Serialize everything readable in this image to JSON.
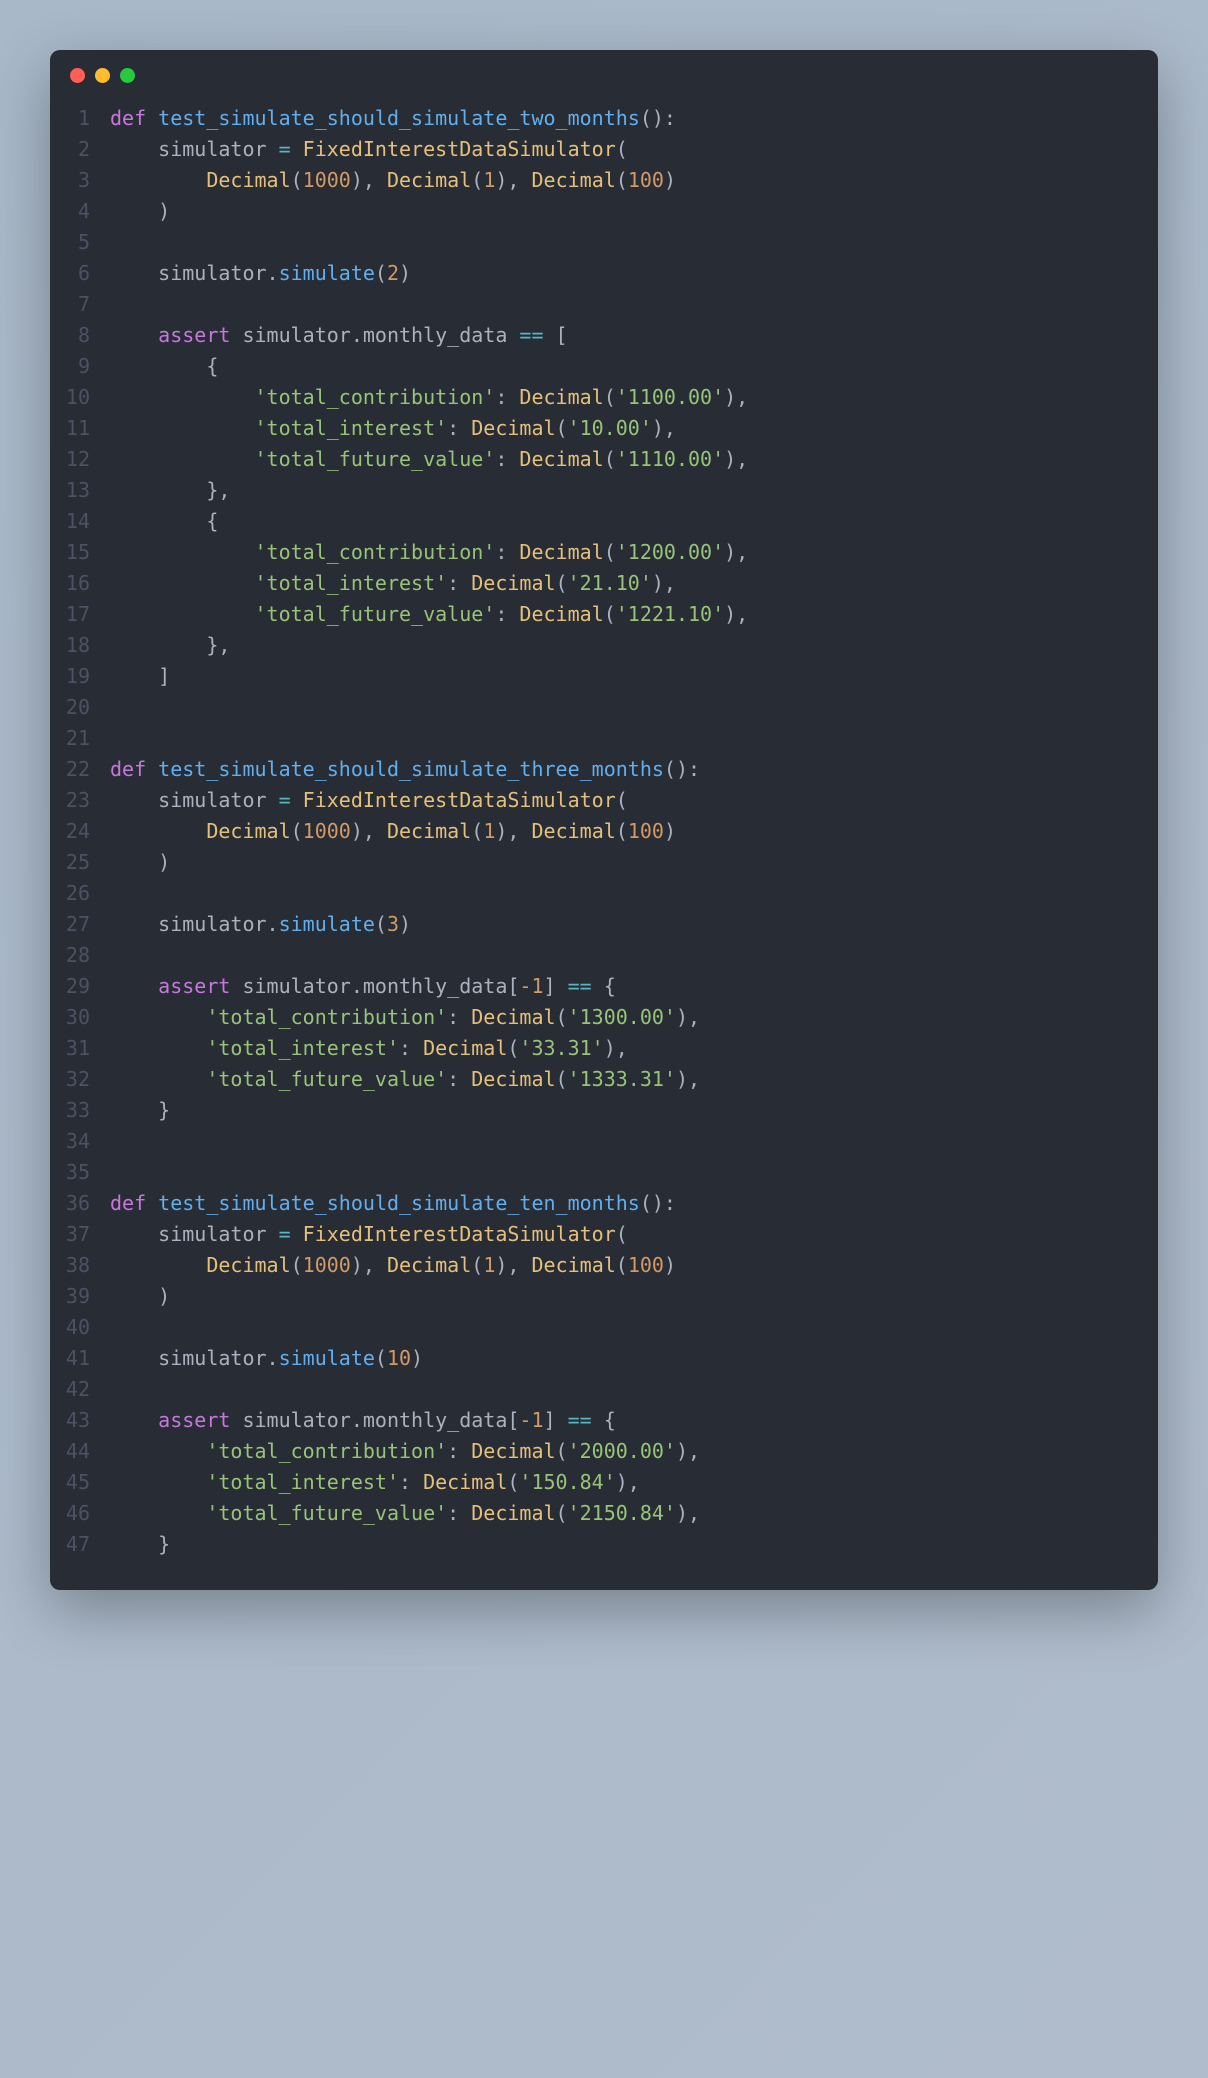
{
  "window": {
    "dots": [
      "red",
      "yellow",
      "green"
    ]
  },
  "code": {
    "lines": [
      {
        "n": 1,
        "tokens": [
          [
            "kw",
            "def"
          ],
          [
            "punct",
            " "
          ],
          [
            "fn",
            "test_simulate_should_simulate_two_months"
          ],
          [
            "punct",
            "():"
          ]
        ]
      },
      {
        "n": 2,
        "tokens": [
          [
            "punct",
            "    simulator "
          ],
          [
            "op",
            "="
          ],
          [
            "punct",
            " "
          ],
          [
            "cls",
            "FixedInterestDataSimulator"
          ],
          [
            "punct",
            "("
          ]
        ]
      },
      {
        "n": 3,
        "tokens": [
          [
            "punct",
            "        "
          ],
          [
            "cls",
            "Decimal"
          ],
          [
            "punct",
            "("
          ],
          [
            "num",
            "1000"
          ],
          [
            "punct",
            "), "
          ],
          [
            "cls",
            "Decimal"
          ],
          [
            "punct",
            "("
          ],
          [
            "num",
            "1"
          ],
          [
            "punct",
            "), "
          ],
          [
            "cls",
            "Decimal"
          ],
          [
            "punct",
            "("
          ],
          [
            "num",
            "100"
          ],
          [
            "punct",
            ")"
          ]
        ]
      },
      {
        "n": 4,
        "tokens": [
          [
            "punct",
            "    )"
          ]
        ]
      },
      {
        "n": 5,
        "tokens": []
      },
      {
        "n": 6,
        "tokens": [
          [
            "punct",
            "    simulator."
          ],
          [
            "fn",
            "simulate"
          ],
          [
            "punct",
            "("
          ],
          [
            "num",
            "2"
          ],
          [
            "punct",
            ")"
          ]
        ]
      },
      {
        "n": 7,
        "tokens": []
      },
      {
        "n": 8,
        "tokens": [
          [
            "punct",
            "    "
          ],
          [
            "kw",
            "assert"
          ],
          [
            "punct",
            " simulator.monthly_data "
          ],
          [
            "op",
            "=="
          ],
          [
            "punct",
            " ["
          ]
        ]
      },
      {
        "n": 9,
        "tokens": [
          [
            "punct",
            "        {"
          ]
        ]
      },
      {
        "n": 10,
        "tokens": [
          [
            "punct",
            "            "
          ],
          [
            "str",
            "'total_contribution'"
          ],
          [
            "punct",
            ": "
          ],
          [
            "cls",
            "Decimal"
          ],
          [
            "punct",
            "("
          ],
          [
            "str",
            "'1100.00'"
          ],
          [
            "punct",
            "),"
          ]
        ]
      },
      {
        "n": 11,
        "tokens": [
          [
            "punct",
            "            "
          ],
          [
            "str",
            "'total_interest'"
          ],
          [
            "punct",
            ": "
          ],
          [
            "cls",
            "Decimal"
          ],
          [
            "punct",
            "("
          ],
          [
            "str",
            "'10.00'"
          ],
          [
            "punct",
            "),"
          ]
        ]
      },
      {
        "n": 12,
        "tokens": [
          [
            "punct",
            "            "
          ],
          [
            "str",
            "'total_future_value'"
          ],
          [
            "punct",
            ": "
          ],
          [
            "cls",
            "Decimal"
          ],
          [
            "punct",
            "("
          ],
          [
            "str",
            "'1110.00'"
          ],
          [
            "punct",
            "),"
          ]
        ]
      },
      {
        "n": 13,
        "tokens": [
          [
            "punct",
            "        },"
          ]
        ]
      },
      {
        "n": 14,
        "tokens": [
          [
            "punct",
            "        {"
          ]
        ]
      },
      {
        "n": 15,
        "tokens": [
          [
            "punct",
            "            "
          ],
          [
            "str",
            "'total_contribution'"
          ],
          [
            "punct",
            ": "
          ],
          [
            "cls",
            "Decimal"
          ],
          [
            "punct",
            "("
          ],
          [
            "str",
            "'1200.00'"
          ],
          [
            "punct",
            "),"
          ]
        ]
      },
      {
        "n": 16,
        "tokens": [
          [
            "punct",
            "            "
          ],
          [
            "str",
            "'total_interest'"
          ],
          [
            "punct",
            ": "
          ],
          [
            "cls",
            "Decimal"
          ],
          [
            "punct",
            "("
          ],
          [
            "str",
            "'21.10'"
          ],
          [
            "punct",
            "),"
          ]
        ]
      },
      {
        "n": 17,
        "tokens": [
          [
            "punct",
            "            "
          ],
          [
            "str",
            "'total_future_value'"
          ],
          [
            "punct",
            ": "
          ],
          [
            "cls",
            "Decimal"
          ],
          [
            "punct",
            "("
          ],
          [
            "str",
            "'1221.10'"
          ],
          [
            "punct",
            "),"
          ]
        ]
      },
      {
        "n": 18,
        "tokens": [
          [
            "punct",
            "        },"
          ]
        ]
      },
      {
        "n": 19,
        "tokens": [
          [
            "punct",
            "    ]"
          ]
        ]
      },
      {
        "n": 20,
        "tokens": []
      },
      {
        "n": 21,
        "tokens": []
      },
      {
        "n": 22,
        "tokens": [
          [
            "kw",
            "def"
          ],
          [
            "punct",
            " "
          ],
          [
            "fn",
            "test_simulate_should_simulate_three_months"
          ],
          [
            "punct",
            "():"
          ]
        ]
      },
      {
        "n": 23,
        "tokens": [
          [
            "punct",
            "    simulator "
          ],
          [
            "op",
            "="
          ],
          [
            "punct",
            " "
          ],
          [
            "cls",
            "FixedInterestDataSimulator"
          ],
          [
            "punct",
            "("
          ]
        ]
      },
      {
        "n": 24,
        "tokens": [
          [
            "punct",
            "        "
          ],
          [
            "cls",
            "Decimal"
          ],
          [
            "punct",
            "("
          ],
          [
            "num",
            "1000"
          ],
          [
            "punct",
            "), "
          ],
          [
            "cls",
            "Decimal"
          ],
          [
            "punct",
            "("
          ],
          [
            "num",
            "1"
          ],
          [
            "punct",
            "), "
          ],
          [
            "cls",
            "Decimal"
          ],
          [
            "punct",
            "("
          ],
          [
            "num",
            "100"
          ],
          [
            "punct",
            ")"
          ]
        ]
      },
      {
        "n": 25,
        "tokens": [
          [
            "punct",
            "    )"
          ]
        ]
      },
      {
        "n": 26,
        "tokens": []
      },
      {
        "n": 27,
        "tokens": [
          [
            "punct",
            "    simulator."
          ],
          [
            "fn",
            "simulate"
          ],
          [
            "punct",
            "("
          ],
          [
            "num",
            "3"
          ],
          [
            "punct",
            ")"
          ]
        ]
      },
      {
        "n": 28,
        "tokens": []
      },
      {
        "n": 29,
        "tokens": [
          [
            "punct",
            "    "
          ],
          [
            "kw",
            "assert"
          ],
          [
            "punct",
            " simulator.monthly_data["
          ],
          [
            "num",
            "-1"
          ],
          [
            "punct",
            "] "
          ],
          [
            "op",
            "=="
          ],
          [
            "punct",
            " {"
          ]
        ]
      },
      {
        "n": 30,
        "tokens": [
          [
            "punct",
            "        "
          ],
          [
            "str",
            "'total_contribution'"
          ],
          [
            "punct",
            ": "
          ],
          [
            "cls",
            "Decimal"
          ],
          [
            "punct",
            "("
          ],
          [
            "str",
            "'1300.00'"
          ],
          [
            "punct",
            "),"
          ]
        ]
      },
      {
        "n": 31,
        "tokens": [
          [
            "punct",
            "        "
          ],
          [
            "str",
            "'total_interest'"
          ],
          [
            "punct",
            ": "
          ],
          [
            "cls",
            "Decimal"
          ],
          [
            "punct",
            "("
          ],
          [
            "str",
            "'33.31'"
          ],
          [
            "punct",
            "),"
          ]
        ]
      },
      {
        "n": 32,
        "tokens": [
          [
            "punct",
            "        "
          ],
          [
            "str",
            "'total_future_value'"
          ],
          [
            "punct",
            ": "
          ],
          [
            "cls",
            "Decimal"
          ],
          [
            "punct",
            "("
          ],
          [
            "str",
            "'1333.31'"
          ],
          [
            "punct",
            "),"
          ]
        ]
      },
      {
        "n": 33,
        "tokens": [
          [
            "punct",
            "    }"
          ]
        ]
      },
      {
        "n": 34,
        "tokens": []
      },
      {
        "n": 35,
        "tokens": []
      },
      {
        "n": 36,
        "tokens": [
          [
            "kw",
            "def"
          ],
          [
            "punct",
            " "
          ],
          [
            "fn",
            "test_simulate_should_simulate_ten_months"
          ],
          [
            "punct",
            "():"
          ]
        ]
      },
      {
        "n": 37,
        "tokens": [
          [
            "punct",
            "    simulator "
          ],
          [
            "op",
            "="
          ],
          [
            "punct",
            " "
          ],
          [
            "cls",
            "FixedInterestDataSimulator"
          ],
          [
            "punct",
            "("
          ]
        ]
      },
      {
        "n": 38,
        "tokens": [
          [
            "punct",
            "        "
          ],
          [
            "cls",
            "Decimal"
          ],
          [
            "punct",
            "("
          ],
          [
            "num",
            "1000"
          ],
          [
            "punct",
            "), "
          ],
          [
            "cls",
            "Decimal"
          ],
          [
            "punct",
            "("
          ],
          [
            "num",
            "1"
          ],
          [
            "punct",
            "), "
          ],
          [
            "cls",
            "Decimal"
          ],
          [
            "punct",
            "("
          ],
          [
            "num",
            "100"
          ],
          [
            "punct",
            ")"
          ]
        ]
      },
      {
        "n": 39,
        "tokens": [
          [
            "punct",
            "    )"
          ]
        ]
      },
      {
        "n": 40,
        "tokens": []
      },
      {
        "n": 41,
        "tokens": [
          [
            "punct",
            "    simulator."
          ],
          [
            "fn",
            "simulate"
          ],
          [
            "punct",
            "("
          ],
          [
            "num",
            "10"
          ],
          [
            "punct",
            ")"
          ]
        ]
      },
      {
        "n": 42,
        "tokens": []
      },
      {
        "n": 43,
        "tokens": [
          [
            "punct",
            "    "
          ],
          [
            "kw",
            "assert"
          ],
          [
            "punct",
            " simulator.monthly_data["
          ],
          [
            "num",
            "-1"
          ],
          [
            "punct",
            "] "
          ],
          [
            "op",
            "=="
          ],
          [
            "punct",
            " {"
          ]
        ]
      },
      {
        "n": 44,
        "tokens": [
          [
            "punct",
            "        "
          ],
          [
            "str",
            "'total_contribution'"
          ],
          [
            "punct",
            ": "
          ],
          [
            "cls",
            "Decimal"
          ],
          [
            "punct",
            "("
          ],
          [
            "str",
            "'2000.00'"
          ],
          [
            "punct",
            "),"
          ]
        ]
      },
      {
        "n": 45,
        "tokens": [
          [
            "punct",
            "        "
          ],
          [
            "str",
            "'total_interest'"
          ],
          [
            "punct",
            ": "
          ],
          [
            "cls",
            "Decimal"
          ],
          [
            "punct",
            "("
          ],
          [
            "str",
            "'150.84'"
          ],
          [
            "punct",
            "),"
          ]
        ]
      },
      {
        "n": 46,
        "tokens": [
          [
            "punct",
            "        "
          ],
          [
            "str",
            "'total_future_value'"
          ],
          [
            "punct",
            ": "
          ],
          [
            "cls",
            "Decimal"
          ],
          [
            "punct",
            "("
          ],
          [
            "str",
            "'2150.84'"
          ],
          [
            "punct",
            "),"
          ]
        ]
      },
      {
        "n": 47,
        "tokens": [
          [
            "punct",
            "    }"
          ]
        ]
      }
    ]
  }
}
